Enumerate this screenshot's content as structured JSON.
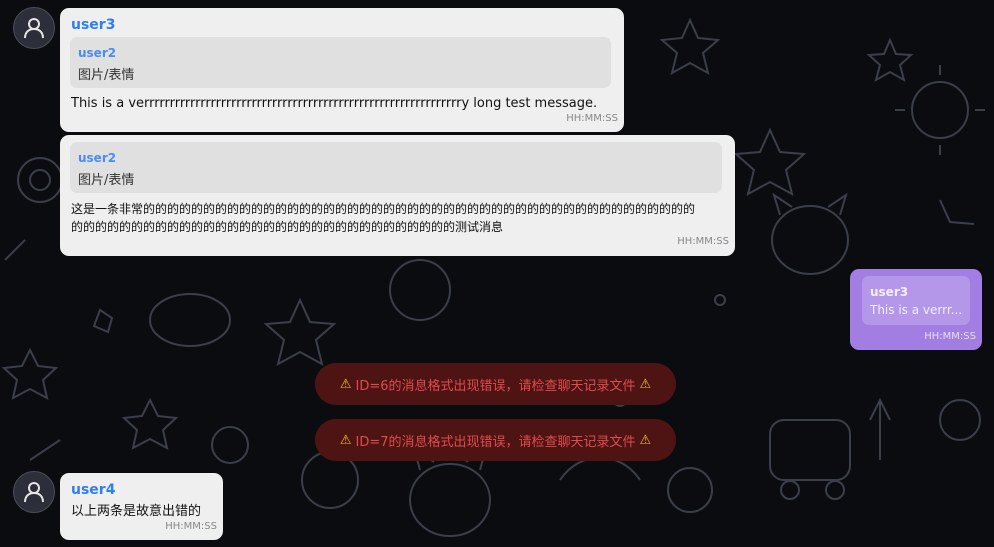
{
  "messages": [
    {
      "username": "user3",
      "quote_user": "user2",
      "quote_text": "图片/表情",
      "text": "This is a verrrrrrrrrrrrrrrrrrrrrrrrrrrrrrrrrrrrrrrrrrrrrrrrrrrrrrrrrrrrrry long test message.",
      "time": "HH:MM:SS"
    },
    {
      "quote_user": "user2",
      "quote_text": "图片/表情",
      "text_line1": "这是一条非常的的的的的的的的的的的的的的的的的的的的的的的的的的的的的的的的的的的的的的的的的的的的的的",
      "text_line2": "的的的的的的的的的的的的的的的的的的的的的的的的的的的的的的的的测试消息",
      "time": "HH:MM:SS"
    },
    {
      "quote_user": "user3",
      "quote_text": "This is a verrr...",
      "time": "HH:MM:SS"
    },
    {
      "username": "user4",
      "text": "以上两条是故意出错的",
      "time": "HH:MM:SS"
    }
  ],
  "errors": [
    {
      "text": "ID=6的消息格式出现错误，请检查聊天记录文件"
    },
    {
      "text": "ID=7的消息格式出现错误，请检查聊天记录文件"
    }
  ],
  "icons": {
    "warning": "warning-icon",
    "avatar": "user-avatar-icon"
  },
  "colors": {
    "username": "#2f7ff0",
    "mine_bubble": "#a27ee2",
    "error_bg": "#4e1414",
    "error_text": "#e04b4b"
  }
}
